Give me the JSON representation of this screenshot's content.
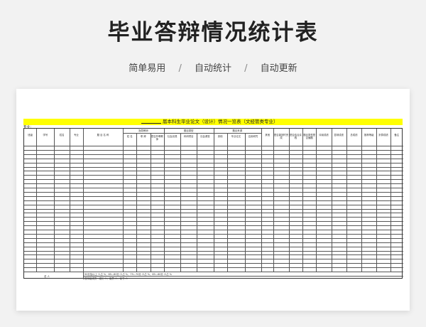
{
  "page": {
    "title": "毕业答辩情况统计表",
    "features": [
      "简单易用",
      "自动统计",
      "自动更新"
    ],
    "separator": "/"
  },
  "sheet": {
    "banner_title": "届本科生毕业论文（设计）情况一览表（文经管类专业）",
    "major_label": "专业：",
    "group_headers": [
      {
        "label": "指导教师",
        "from": 6,
        "to": 8
      },
      {
        "label": "题目类型",
        "from": 9,
        "to": 11
      },
      {
        "label": "题目来源",
        "from": 12,
        "to": 14
      }
    ],
    "columns": [
      {
        "w": 18,
        "label": "班级"
      },
      {
        "w": 26,
        "label": "学号"
      },
      {
        "w": 22,
        "label": "姓名"
      },
      {
        "w": 20,
        "label": "专业"
      },
      {
        "w": 58,
        "label": "题 目 名 称"
      },
      {
        "w": 20,
        "label": "姓 名"
      },
      {
        "w": 20,
        "label": "职 称"
      },
      {
        "w": 20,
        "label": "是否外聘教师"
      },
      {
        "w": 24,
        "label": "社会实践"
      },
      {
        "w": 24,
        "label": "科研项目"
      },
      {
        "w": 24,
        "label": "社会调查"
      },
      {
        "w": 20,
        "label": "其他"
      },
      {
        "w": 26,
        "label": "毕业论文"
      },
      {
        "w": 24,
        "label": "应用研究"
      },
      {
        "w": 18,
        "label": "其他"
      },
      {
        "w": 22,
        "label": "是否能按时完成"
      },
      {
        "w": 20,
        "label": "是否结合实践"
      },
      {
        "w": 20,
        "label": "题目类型是否偏题"
      },
      {
        "w": 22,
        "label": "评阅成绩"
      },
      {
        "w": 22,
        "label": "答辩成绩"
      },
      {
        "w": 22,
        "label": "总成绩"
      },
      {
        "w": 22,
        "label": "推荐等级"
      },
      {
        "w": 20,
        "label": "折算成绩"
      },
      {
        "w": 19,
        "label": "备注"
      }
    ],
    "data_rows": 30,
    "footer_left": "总  人",
    "footer_line1": "90分及以上 人占 %，89—80分 人占 %，79—70分 人占 %，69—60分 人占 %",
    "footer_line2": "答辩组成员：组长 人，组员 人，秘书 人"
  }
}
